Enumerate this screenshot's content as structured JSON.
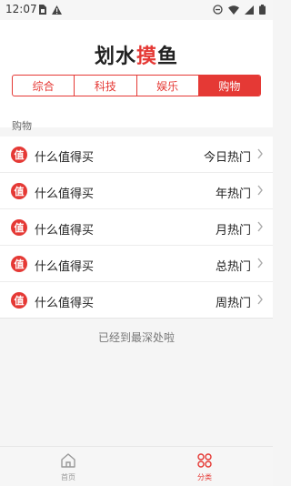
{
  "status_bar": {
    "time": "12:07"
  },
  "app": {
    "title_part1": "划水",
    "title_accent": "摸",
    "title_part2": "鱼"
  },
  "tabs": [
    {
      "label": "综合",
      "active": false
    },
    {
      "label": "科技",
      "active": false
    },
    {
      "label": "娱乐",
      "active": false
    },
    {
      "label": "购物",
      "active": true
    }
  ],
  "section": {
    "label": "购物"
  },
  "list": [
    {
      "name": "什么值得买",
      "category": "今日热门"
    },
    {
      "name": "什么值得买",
      "category": "年热门"
    },
    {
      "name": "什么值得买",
      "category": "月热门"
    },
    {
      "name": "什么值得买",
      "category": "总热门"
    },
    {
      "name": "什么值得买",
      "category": "周热门"
    }
  ],
  "footer": {
    "end_text": "已经到最深处啦"
  },
  "bottom_nav": [
    {
      "label": "首页",
      "active": false
    },
    {
      "label": "分类",
      "active": true
    }
  ],
  "colors": {
    "accent": "#e53935"
  }
}
